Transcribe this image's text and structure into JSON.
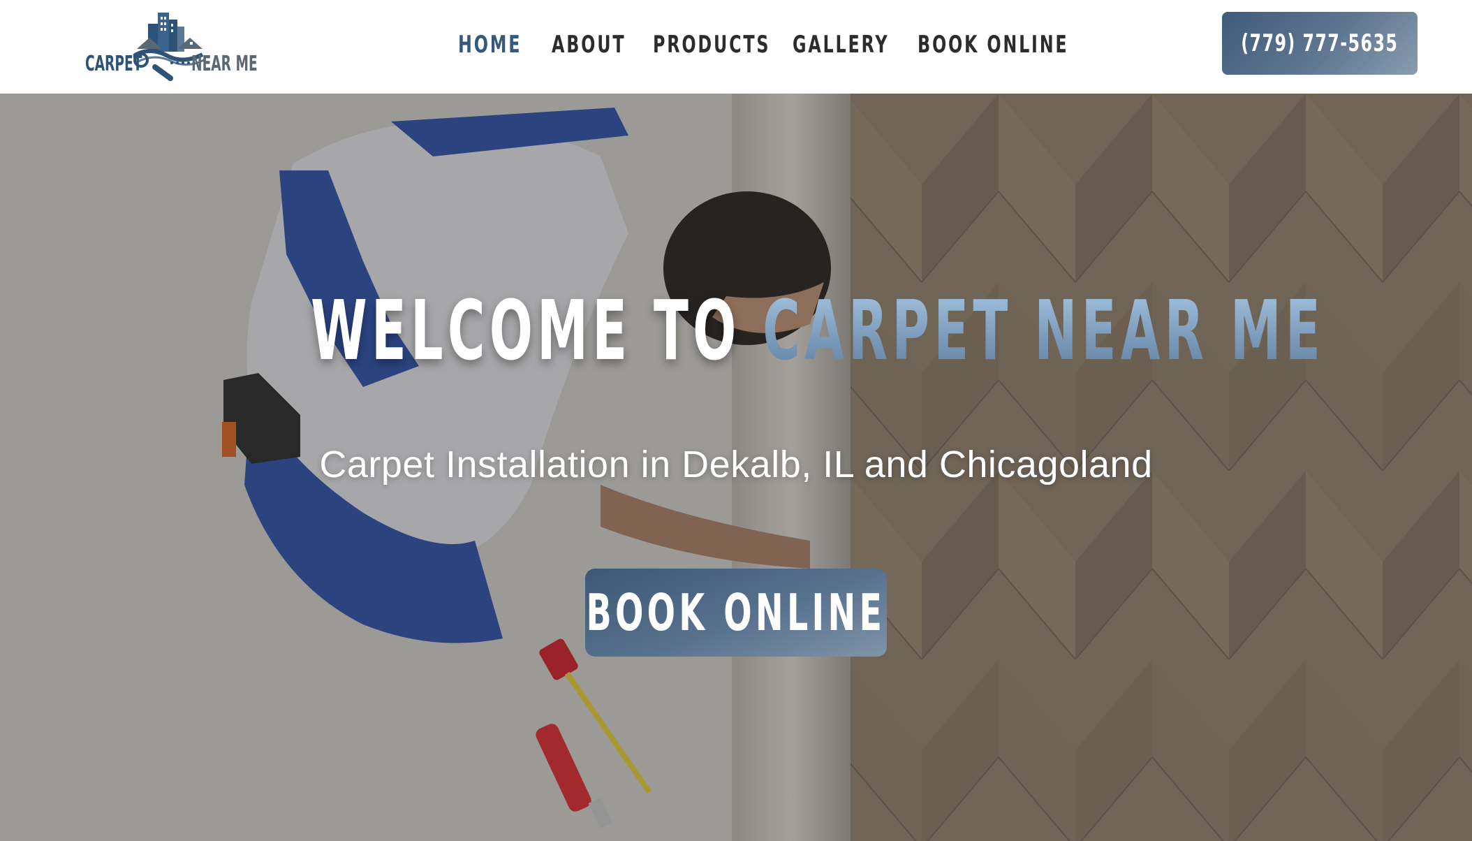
{
  "logo": {
    "word_left": "CARPET",
    "word_right": "NEAR ME",
    "icon": "house-buildings-logo-icon"
  },
  "nav": {
    "items": [
      {
        "label": "HOME",
        "active": true
      },
      {
        "label": "ABOUT",
        "active": false
      },
      {
        "label": "PRODUCTS",
        "active": false
      },
      {
        "label": "GALLERY",
        "active": false
      },
      {
        "label": "BOOK ONLINE",
        "active": false
      }
    ]
  },
  "header": {
    "phone_label": "(779) 777-5635"
  },
  "hero": {
    "title_white": "WELCOME TO",
    "title_accent": "CARPET NEAR ME",
    "subtitle": "Carpet Installation in Dekalb, IL and Chicagoland",
    "cta_label": "BOOK ONLINE",
    "image": "installer-rolling-carpet-photo"
  },
  "colors": {
    "brand_blue": "#36587d",
    "button_gradient_start": "#3f5a7a",
    "button_gradient_end": "#8a9db0",
    "nav_text": "#2c2c2c",
    "accent_title": "#8aa9c8"
  }
}
